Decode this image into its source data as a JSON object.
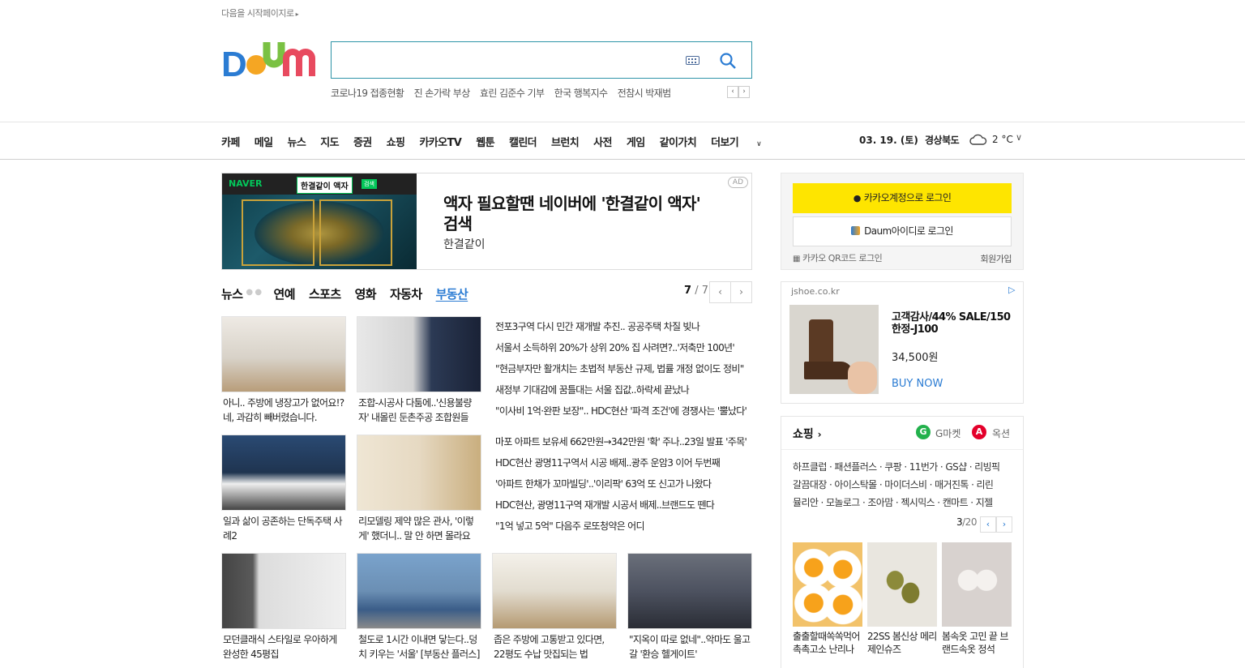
{
  "header": {
    "start_page": "다음을 시작페이지로",
    "logo": "Daum",
    "search_placeholder": "",
    "keywords": [
      "코로나19 접종현황",
      "진 손가락 부상",
      "효린 김준수 기부",
      "한국 행복지수",
      "전참시 박재범"
    ]
  },
  "nav": {
    "items": [
      "카페",
      "메일",
      "뉴스",
      "지도",
      "증권",
      "쇼핑",
      "카카오TV",
      "웹툰",
      "캘린더",
      "브런치",
      "사전",
      "게임",
      "같이가치"
    ],
    "more": "더보기",
    "date": "03. 19. (토)",
    "region": "경상북도",
    "temp": "2 °C"
  },
  "banner_ad": {
    "brand": "NAVER",
    "tag": "한결같이 액자",
    "tag_sub": "검색",
    "title": "액자 필요할땐 네이버에 '한결같이 액자' 검색",
    "subtitle": "한결같이",
    "label": "AD"
  },
  "news": {
    "tabs": [
      "뉴스",
      "연예",
      "스포츠",
      "영화",
      "자동차",
      "부동산"
    ],
    "active_tab": "부동산",
    "page_current": "7",
    "page_total": "/ 7",
    "thumbs": [
      {
        "caption": "아니.. 주방에 냉장고가 없어요!? 네, 과감히 빼버렸습니다.",
        "color": "#d8d2c8"
      },
      {
        "caption": "조합-시공사 다툼에..'신용불량자' 내몰린 둔촌주공 조합원들",
        "color": "#2c3a55"
      },
      {
        "caption": "일과 삶이 공존하는 단독주택 사례2",
        "color": "#1f3450"
      },
      {
        "caption": "리모델링 제약 많은 관사, '이렇게' 했더니.. 말 안 하면 몰라요",
        "color": "#e6d9c2"
      },
      {
        "caption": "모던클래식 스타일로 우아하게 완성한 45평집",
        "color": "#c9c9c9"
      },
      {
        "caption": "철도로 1시간 이내면 닿는다..덩치 키우는 '서울' [부동산 플러스]",
        "color": "#6b8fb4"
      },
      {
        "caption": "좁은 주방에 고통받고 있다면, 22평도 수납 맛집되는 법",
        "color": "#e2dccf"
      },
      {
        "caption": "\"지옥이 따로 없네\"..악마도 울고 갈 '환승 헬게이트'",
        "color": "#4d5260"
      }
    ],
    "headlines": [
      "전포3구역 다시 민간 재개발 추진.. 공공주택 차질 빚나",
      "서울서 소득하위 20%가 상위 20% 집 사려면?..'저축만 100년'",
      "\"현금부자만 활개치는 초법적 부동산 규제, 법률 개정 없이도 정비\"",
      "새정부 기대감에 꿈틀대는 서울 집값..하락세 끝났나",
      "\"이사비 1억·완판 보장\".. HDC현산 '파격 조건'에 경쟁사는 '뿔났다'"
    ],
    "headlines2": [
      "마포 아파트 보유세 662만원→342만원 '확' 주나..23일 발표 '주목'",
      "HDC현산 광명11구역서 시공 배제..광주 운암3 이어 두번째",
      "'아파트 한채가 꼬마빌딩'..'이리팍' 63억 또 신고가 나왔다",
      "HDC현산, 광명11구역 재개발 시공서 배제..브랜드도 뗀다",
      "\"1억 넣고 5억\" 다음주 로또청약은 어디"
    ]
  },
  "login": {
    "kakao": "카카오계정으로 로그인",
    "daum": "Daum아이디로 로그인",
    "qr": "카카오 QR코드 로그인",
    "join": "회원가입"
  },
  "side_ad": {
    "domain": "jshoe.co.kr",
    "title": "고객감사/44% SALE/150한정-J100",
    "price": "34,500원",
    "buy": "BUY NOW"
  },
  "shopping": {
    "title": "쇼핑",
    "gmarket": "G마켓",
    "auction": "옥션",
    "links": [
      "하프클럽 · 패션플러스 · 쿠팡 · 11번가 · GS샵 · 리빙픽",
      "갈끔대장 · 아이스탁몰 · 마이더스비 · 매거진톡 · 리린",
      "뮬리안 · 모놀로그 · 조아맘 · 젝시믹스 · 캔마트 · 지젤"
    ],
    "page_current": "3",
    "page_total": "/20",
    "products": [
      {
        "caption": "출출할때쏙쏙먹어 촉촉고소 난리나",
        "color": "#f2c26a"
      },
      {
        "caption": "22SS 봄신상 메리제인슈즈",
        "color": "#e9e6df"
      },
      {
        "caption": "봄속옷 고민 끝 브랜드속옷 정석",
        "color": "#d8d2cf"
      }
    ]
  }
}
